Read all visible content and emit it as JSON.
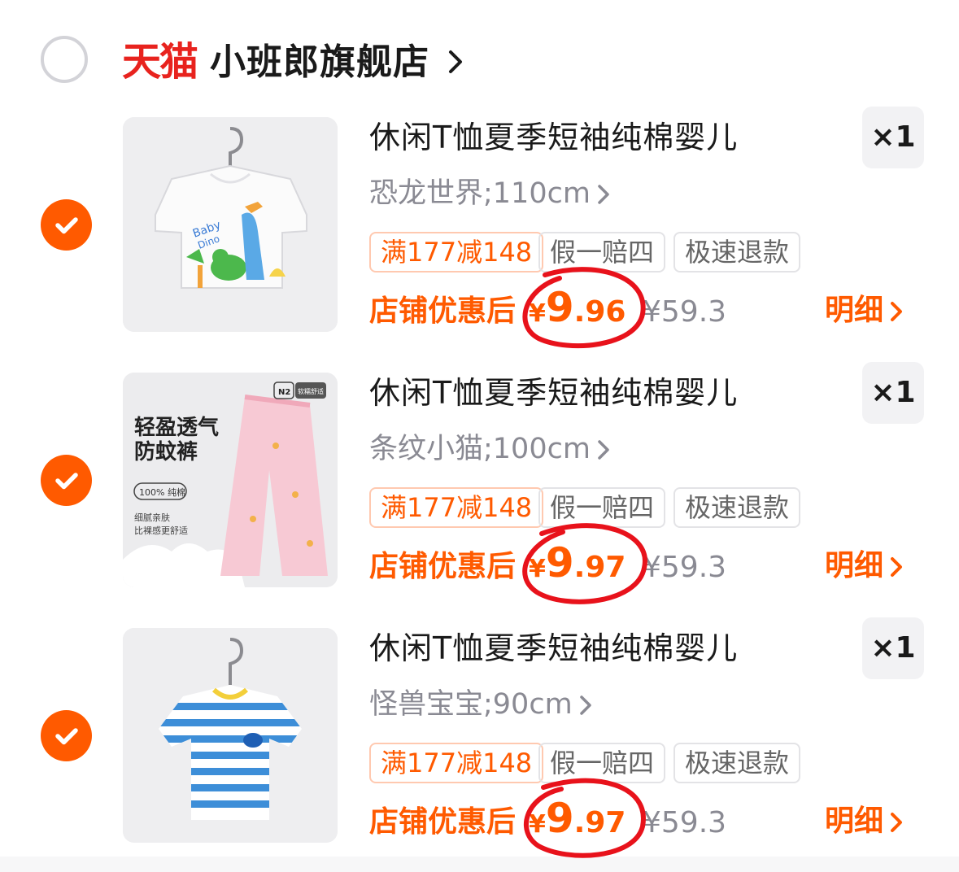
{
  "store": {
    "platform_logo": "天猫",
    "name": "小班郎旗舰店"
  },
  "colors": {
    "accent": "#ff5a00",
    "tmall_red": "#e8231e",
    "annotation_red": "#e8121b"
  },
  "items": [
    {
      "title": "休闲T恤夏季短袖纯棉婴儿",
      "sku": "恐龙世界;110cm",
      "qty": "×1",
      "tags": [
        "满177减148",
        "假一赔四",
        "极速退款"
      ],
      "deal_label": "店铺优惠后",
      "deal_price_currency": "¥",
      "deal_price_int": "9",
      "deal_price_dec": ".96",
      "original_price": "¥59.3",
      "detail_label": "明细",
      "image_icon": "dinosaur-tshirt-image",
      "checked": true
    },
    {
      "title": "休闲T恤夏季短袖纯棉婴儿",
      "sku": "条纹小猫;100cm",
      "qty": "×1",
      "tags": [
        "满177减148",
        "假一赔四",
        "极速退款"
      ],
      "deal_label": "店铺优惠后",
      "deal_price_currency": "¥",
      "deal_price_int": "9",
      "deal_price_dec": ".97",
      "original_price": "¥59.3",
      "detail_label": "明细",
      "image_icon": "mosquito-pants-image",
      "image_text": {
        "badge": "N2",
        "badge_sub": "软糯舒适",
        "headline1": "轻盈透气",
        "headline2": "防蚊裤",
        "pill": "100% 纯棉",
        "sub1": "细腻亲肤",
        "sub2": "比裸感更舒适"
      },
      "checked": true
    },
    {
      "title": "休闲T恤夏季短袖纯棉婴儿",
      "sku": "怪兽宝宝;90cm",
      "qty": "×1",
      "tags": [
        "满177减148",
        "假一赔四",
        "极速退款"
      ],
      "deal_label": "店铺优惠后",
      "deal_price_currency": "¥",
      "deal_price_int": "9",
      "deal_price_dec": ".97",
      "original_price": "¥59.3",
      "detail_label": "明细",
      "image_icon": "striped-tshirt-image",
      "checked": true
    }
  ]
}
